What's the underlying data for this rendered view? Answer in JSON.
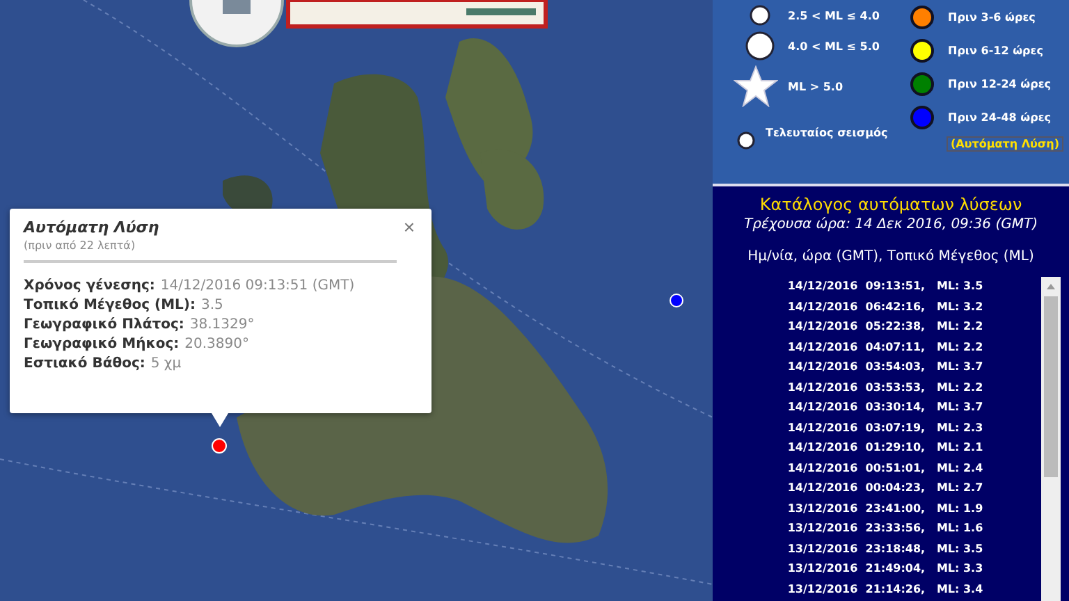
{
  "map": {
    "popup": {
      "title": "Αυτόματη Λύση",
      "subtitle": "(πριν από 22 λεπτά)",
      "close": "×",
      "fields": [
        {
          "label": "Χρόνος γένεσης:",
          "value": "14/12/2016  09:13:51 (GMT)"
        },
        {
          "label": "Τοπικό Μέγεθος (ML):",
          "value": "3.5"
        },
        {
          "label": "Γεωγραφικό Πλάτος:",
          "value": "38.1329°"
        },
        {
          "label": "Γεωγραφικό Μήκος:",
          "value": "20.3890°"
        },
        {
          "label": "Εστιακό Βάθος:",
          "value": "5 χμ"
        }
      ]
    },
    "markers": [
      {
        "color": "#ff0000"
      },
      {
        "color": "#0000ff"
      }
    ]
  },
  "legend": {
    "magnitudes": [
      {
        "kind": "small",
        "label": "2.5 < ML ≤ 4.0"
      },
      {
        "kind": "medium",
        "label": "4.0 < ML ≤ 5.0"
      },
      {
        "kind": "star",
        "label": "ML > 5.0"
      },
      {
        "kind": "last",
        "label": "Τελευταίος σεισμός"
      }
    ],
    "ages": [
      {
        "color": "#ff7f00",
        "label": "Πριν 3-6 ώρες"
      },
      {
        "color": "#ffff00",
        "label": "Πριν 6-12 ώρες"
      },
      {
        "color": "#008000",
        "label": "Πριν 12-24 ώρες"
      },
      {
        "color": "#0000ff",
        "label": "Πριν 24-48 ώρες"
      }
    ],
    "note": "(Αυτόματη Λύση)"
  },
  "catalog": {
    "title": "Κατάλογος αυτόματων λύσεων",
    "current_time": "Τρέχουσα ώρα:  14 Δεκ 2016, 09:36 (GMT)",
    "header": "Ημ/νία, ώρα (GMT), Τοπικό Μέγεθος (ML)",
    "rows": [
      "14/12/2016  09:13:51,   ML: 3.5",
      "14/12/2016  06:42:16,   ML: 3.2",
      "14/12/2016  05:22:38,   ML: 2.2",
      "14/12/2016  04:07:11,   ML: 2.2",
      "14/12/2016  03:54:03,   ML: 3.7",
      "14/12/2016  03:53:53,   ML: 2.2",
      "14/12/2016  03:30:14,   ML: 3.7",
      "14/12/2016  03:07:19,   ML: 2.3",
      "14/12/2016  01:29:10,   ML: 2.1",
      "14/12/2016  00:51:01,   ML: 2.4",
      "14/12/2016  00:04:23,   ML: 2.7",
      "13/12/2016  23:41:00,   ML: 1.9",
      "13/12/2016  23:33:56,   ML: 1.6",
      "13/12/2016  23:18:48,   ML: 3.5",
      "13/12/2016  21:49:04,   ML: 3.3",
      "13/12/2016  21:14:26,   ML: 3.4"
    ]
  }
}
